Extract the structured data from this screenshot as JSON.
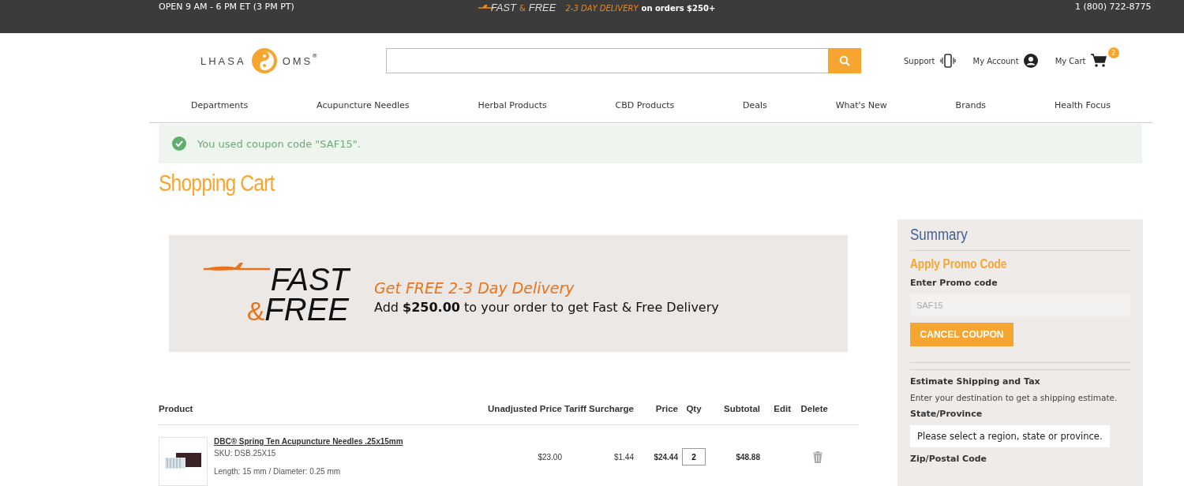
{
  "top_bar": {
    "hours": "OPEN 9 AM - 6 PM ET (3 PM PT)",
    "promo_fast": "FAST",
    "promo_amp": "&",
    "promo_free": "FREE",
    "promo_delivery": "2-3 DAY DELIVERY",
    "promo_orders": "on orders $250+",
    "phone": "1 (800) 722-8775"
  },
  "header": {
    "logo_left": "LHASA",
    "logo_right": "OMS",
    "logo_mark": "®",
    "support": "Support",
    "account": "My Account",
    "cart": "My Cart",
    "cart_count": "2"
  },
  "nav": [
    "Departments",
    "Acupuncture Needles",
    "Herbal Products",
    "CBD Products",
    "Deals",
    "What's New",
    "Brands",
    "Health Focus"
  ],
  "message": "You used coupon code \"SAF15\".",
  "title": "Shopping Cart",
  "banner": {
    "logo_fast": "FAST",
    "logo_amp": "&",
    "logo_free": "FREE",
    "headline": "Get FREE 2-3 Day Delivery",
    "text": "Add **$250.00** to your order to get Fast & Free Delivery"
  },
  "table": {
    "columns": [
      "Product",
      "Unadjusted Price",
      "Tariff Surcharge",
      "Price",
      "Qty",
      "Subtotal",
      "Edit",
      "Delete"
    ],
    "rows": [
      {
        "name": "DBC® Spring Ten Acupuncture Needles .25x15mm",
        "sku": "SKU: DSB.25X15",
        "options": "Length: 15 mm / Diameter: 0.25 mm",
        "unadjusted": "$23.00",
        "tariff": "$1.44",
        "price": "$24.44",
        "qty": "2",
        "subtotal": "$48.88"
      }
    ]
  },
  "summary": {
    "title": "Summary",
    "promo_title": "Apply Promo Code",
    "promo_label": "Enter Promo code",
    "promo_value": "SAF15",
    "cancel_button": "CANCEL COUPON",
    "shipping_title": "Estimate Shipping and Tax",
    "shipping_text": "Enter your destination to get a shipping estimate.",
    "state_label": "State/Province",
    "state_value": "Please select a region, state or province.",
    "zip_label": "Zip/Postal Code"
  }
}
